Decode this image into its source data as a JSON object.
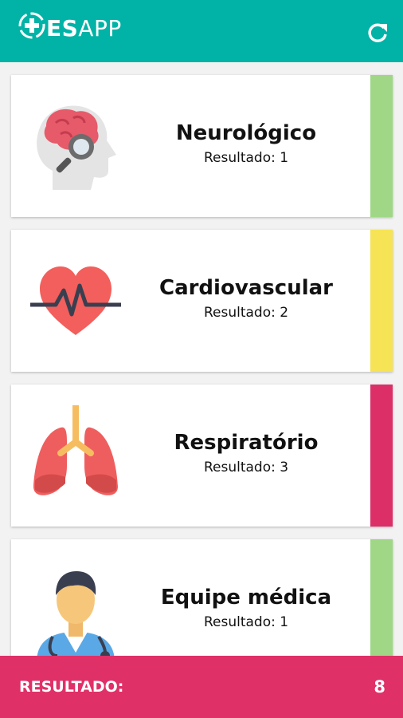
{
  "app": {
    "logo_bold": "ES",
    "logo_rest": "APP"
  },
  "colors": {
    "header": "#00b3a6",
    "footer": "#e03068",
    "green": "#9fd786",
    "yellow": "#f6e356",
    "red": "#dc2f68"
  },
  "cards": [
    {
      "title": "Neurológico",
      "result": "Resultado: 1",
      "status_color": "#9fd786",
      "icon": "brain-head-icon"
    },
    {
      "title": "Cardiovascular",
      "result": "Resultado: 2",
      "status_color": "#f6e356",
      "icon": "heart-pulse-icon"
    },
    {
      "title": "Respiratório",
      "result": "Resultado: 3",
      "status_color": "#dc2f68",
      "icon": "lungs-icon"
    },
    {
      "title": "Equipe médica",
      "result": "Resultado: 1",
      "status_color": "#9fd786",
      "icon": "doctor-icon"
    }
  ],
  "footer": {
    "label": "RESULTADO:",
    "value": "8"
  }
}
